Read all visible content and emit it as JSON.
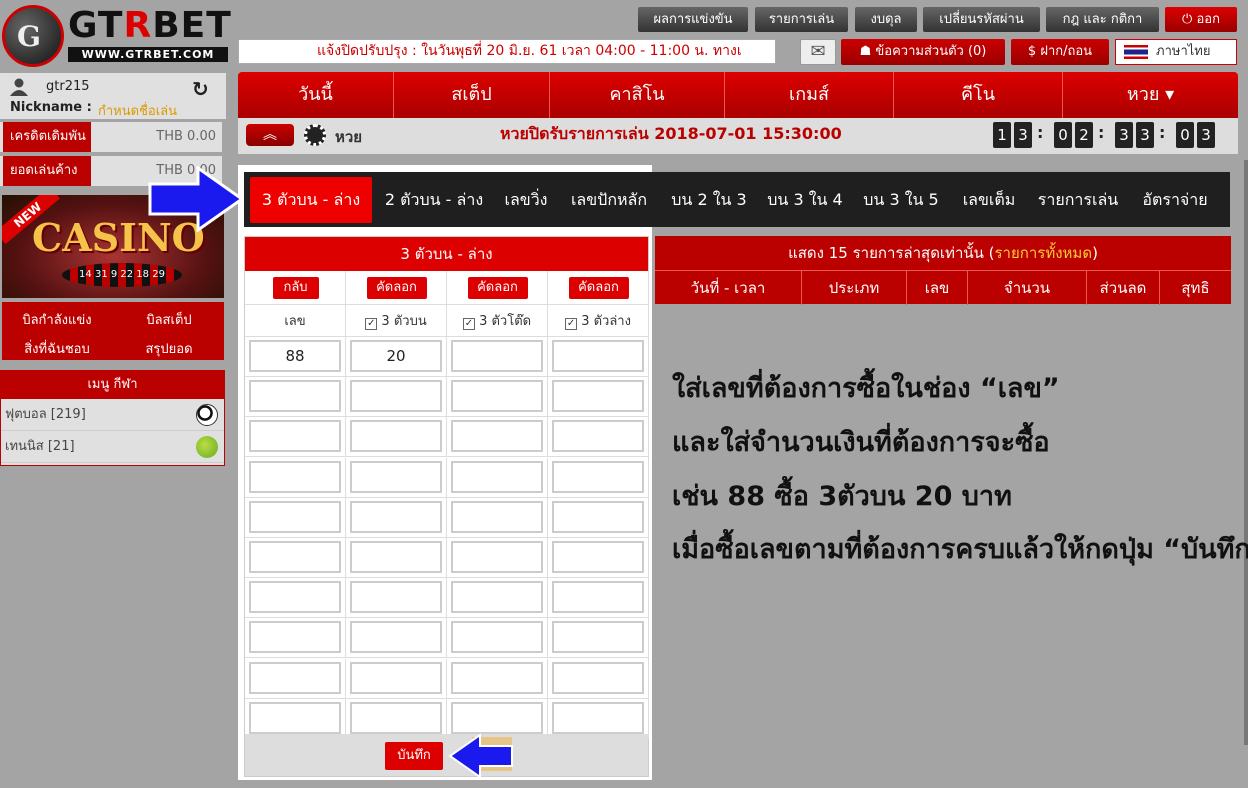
{
  "brand": {
    "logo_mark": "G",
    "logo_prefix": "GT",
    "logo_r": "R",
    "logo_suffix": "BET",
    "url": "WWW.GTRBET.COM"
  },
  "top_nav": [
    {
      "label": "ผลการแข่งขัน"
    },
    {
      "label": "รายการเล่น"
    },
    {
      "label": "งบดุล"
    },
    {
      "label": "เปลี่ยนรหัสผ่าน"
    },
    {
      "label": "กฎ และ กติกา"
    },
    {
      "label": "⏻ ออก"
    }
  ],
  "announcement": "แจ้งปิดปรับปรุง : ในวันพุธที่ 20 มิ.ย. 61 เวลา 04:00 - 11:00 น. ทางเ",
  "messages_label": "ข้อความส่วนตัว (0)",
  "deposit_label": "ฝาก/ถอน",
  "language_label": "ภาษาไทย",
  "user": {
    "username": "gtr215",
    "nickname_label": "Nickname :",
    "nickname_value": "กำหนดชื่อเล่น"
  },
  "balances": [
    {
      "label": "เครดิตเดิมพัน",
      "value": "THB 0.00"
    },
    {
      "label": "ยอดเล่นค้าง",
      "value": "THB 0.00"
    }
  ],
  "casino_banner": {
    "text": "CASINO",
    "tag": "NEW",
    "wheel": "14 31 9 22 18 29"
  },
  "bet_menu": [
    "บิลกำลังแข่ง",
    "บิลสเต็ป",
    "สิ่งที่ฉันชอบ",
    "สรุปยอด"
  ],
  "sports": {
    "title": "เมนู กีฬา",
    "items": [
      {
        "label": "ฟุตบอล [219]",
        "icon": "soccer-ball-icon"
      },
      {
        "label": "เทนนิส [21]",
        "icon": "tennis-ball-icon"
      }
    ]
  },
  "main_nav": [
    "วันนี้",
    "สเต็ป",
    "คาสิโน",
    "เกมส์",
    "คีโน",
    "หวย ▾"
  ],
  "lottery_bar": {
    "title": "หวย",
    "close_info": "หวยปิดรับรายการเล่น 2018-07-01 15:30:00",
    "countdown": [
      "1",
      "3",
      "0",
      "2",
      "3",
      "3",
      "0",
      "3"
    ]
  },
  "tabs": [
    "3 ตัวบน - ล่าง",
    "2 ตัวบน - ล่าง",
    "เลขวิ่ง",
    "เลขปักหลัก",
    "บน 2 ใน 3",
    "บน 3 ใน 4",
    "บน 3 ใน 5",
    "เลขเต็ม",
    "รายการเล่น",
    "อัตราจ่าย"
  ],
  "form": {
    "title": "3 ตัวบน - ล่าง",
    "buttons": [
      "กลับ",
      "คัดลอก",
      "คัดลอก",
      "คัดลอก"
    ],
    "col_labels": [
      "เลข",
      "3 ตัวบน",
      "3 ตัวโต๊ด",
      "3 ตัวล่าง"
    ],
    "rows": [
      [
        "88",
        "20",
        "",
        ""
      ],
      [
        "",
        "",
        "",
        ""
      ],
      [
        "",
        "",
        "",
        ""
      ],
      [
        "",
        "",
        "",
        ""
      ],
      [
        "",
        "",
        "",
        ""
      ],
      [
        "",
        "",
        "",
        ""
      ],
      [
        "",
        "",
        "",
        ""
      ],
      [
        "",
        "",
        "",
        ""
      ],
      [
        "",
        "",
        "",
        ""
      ],
      [
        "",
        "",
        "",
        ""
      ]
    ],
    "save_label": "บันทึก"
  },
  "recent": {
    "title_prefix": "แสดง 15 รายการล่าสุดเท่านั้น (",
    "title_link": "รายการทั้งหมด",
    "title_suffix": ")",
    "columns": [
      "วันที่ - เวลา",
      "ประเภท",
      "เลข",
      "จำนวน",
      "ส่วนลด",
      "สุทธิ"
    ]
  },
  "instructions": [
    "ใส่เลขที่ต้องการซื้อในช่อง “เลข”",
    "และใส่จำนวนเงินที่ต้องการจะซื้อ",
    "เช่น 88 ซื้อ 3ตัวบน 20 บาท",
    "เมื่อซื้อเลขตามที่ต้องการครบแล้วให้กดปุ่ม “บันทึก”"
  ],
  "colors": {
    "brand_red": "#dd0000",
    "dark_red": "#aa0000",
    "tab_bar": "#1f1f1f",
    "arrow_blue": "#1a1aee"
  }
}
